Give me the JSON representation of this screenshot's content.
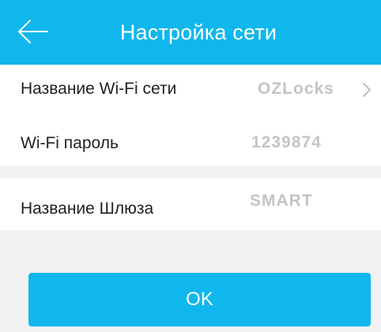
{
  "header": {
    "title": "Настройка сети",
    "back_icon": "back-arrow-icon"
  },
  "settings": [
    {
      "label": "Название Wi-Fi сети",
      "value": "OZLocks",
      "has_chevron": true
    },
    {
      "label": "Wi-Fi пароль",
      "value": "1239874",
      "has_chevron": false
    },
    {
      "label": "Название Шлюза",
      "value": "SMART",
      "has_chevron": false
    }
  ],
  "actions": {
    "ok_label": "OK"
  },
  "colors": {
    "accent": "#10b7ec",
    "background": "#f2f2f2",
    "row_background": "#ffffff",
    "label_text": "#222222",
    "value_text": "#c4c4c4"
  }
}
